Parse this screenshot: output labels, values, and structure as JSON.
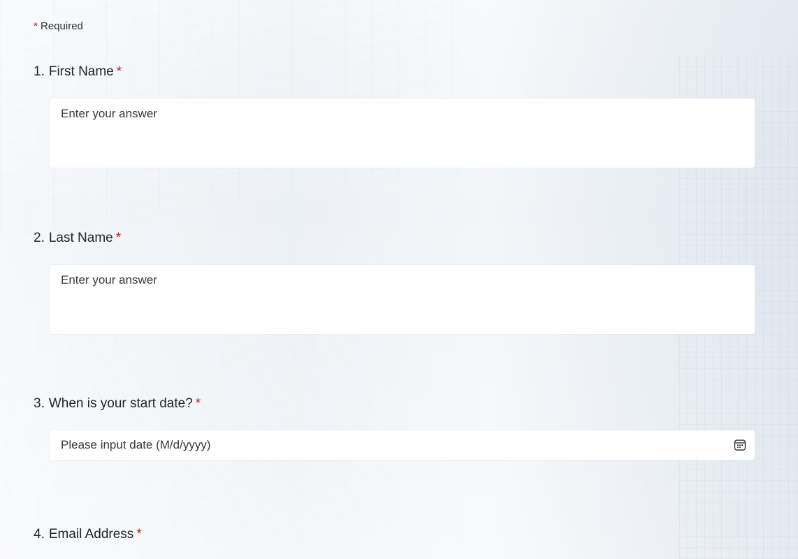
{
  "form": {
    "required_note": {
      "asterisk": "*",
      "label": "Required"
    },
    "questions": [
      {
        "number": "1.",
        "title": "First Name",
        "required_marker": "*",
        "type": "text",
        "value": "",
        "placeholder": "Enter your answer"
      },
      {
        "number": "2.",
        "title": "Last Name",
        "required_marker": "*",
        "type": "text",
        "value": "",
        "placeholder": "Enter your answer"
      },
      {
        "number": "3.",
        "title": "When is your start date?",
        "required_marker": "*",
        "type": "date",
        "value": "",
        "placeholder": "Please input date (M/d/yyyy)",
        "icon": "calendar-icon"
      },
      {
        "number": "4.",
        "title": "Email Address",
        "required_marker": "*",
        "type": "text"
      }
    ]
  },
  "colors": {
    "required_asterisk": "#a4262c",
    "input_background": "#ffffff",
    "page_background": "#eef2f6",
    "text": "#242424"
  }
}
